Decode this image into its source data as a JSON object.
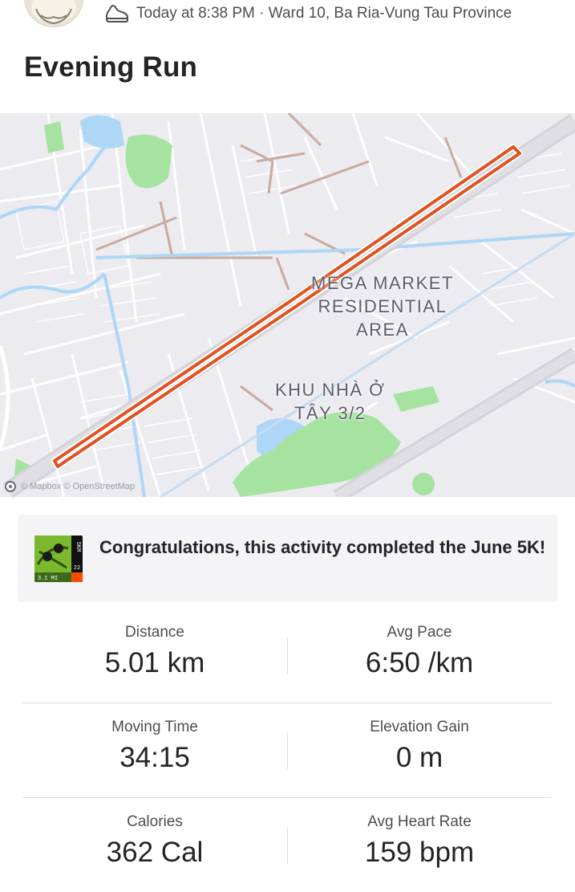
{
  "header": {
    "meta_text": "Today at 8:38 PM · Ward 10, Ba Ria-Vung Tau Province",
    "icons": {
      "activity": "shoe-icon",
      "avatar": "avatar"
    }
  },
  "activity": {
    "title": "Evening Run"
  },
  "map": {
    "labels": {
      "area1": [
        "MEGA MARKET",
        "RESIDENTIAL",
        "AREA"
      ],
      "area2": [
        "KHU NHÀ Ở",
        "TÂY 3/2"
      ]
    },
    "attribution": "© Mapbox © OpenStreetMap",
    "route_color": "#e2511f"
  },
  "achievement": {
    "text": "Congratulations, this activity completed the June 5K!",
    "badge": {
      "side_text": "5KM",
      "year": "22",
      "distance": "3.1 MI"
    }
  },
  "stats": [
    {
      "left": {
        "label": "Distance",
        "value": "5.01 km"
      },
      "right": {
        "label": "Avg Pace",
        "value": "6:50 /km"
      }
    },
    {
      "left": {
        "label": "Moving Time",
        "value": "34:15"
      },
      "right": {
        "label": "Elevation Gain",
        "value": "0 m"
      }
    },
    {
      "left": {
        "label": "Calories",
        "value": "362 Cal"
      },
      "right": {
        "label": "Avg Heart Rate",
        "value": "159 bpm"
      }
    }
  ],
  "colors": {
    "accent": "#fc4c02",
    "route": "#e2511f",
    "map_bg": "#ecebf0",
    "water": "#aed6f6",
    "park": "#a6e3a0"
  }
}
